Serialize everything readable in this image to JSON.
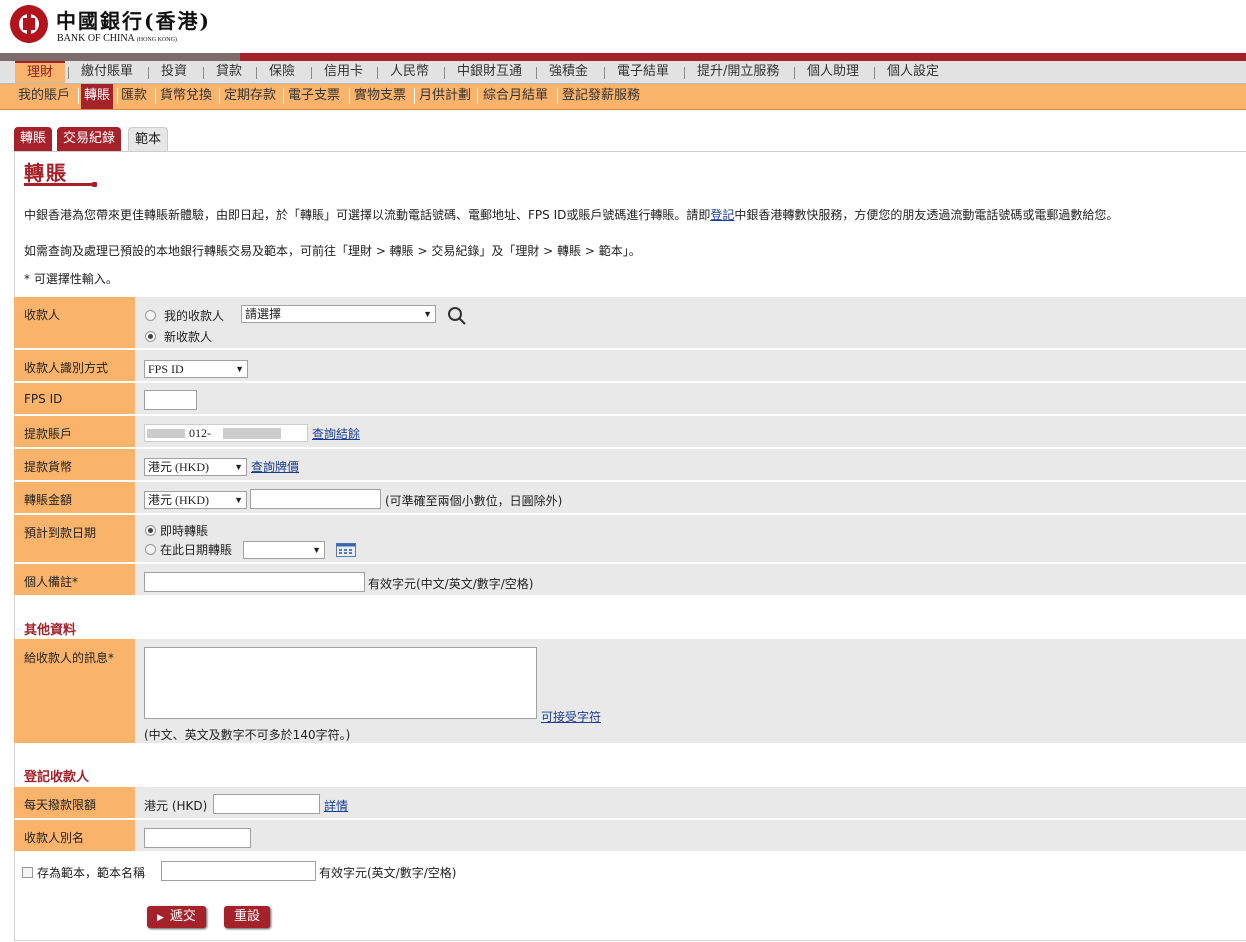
{
  "header": {
    "logo_cn": "中國銀行(香港)",
    "logo_en": "BANK OF CHINA",
    "logo_en_small": "(HONG KONG)"
  },
  "nav_main": [
    "理財",
    "繳付賬單",
    "投資",
    "貸款",
    "保險",
    "信用卡",
    "人民幣",
    "中銀財互通",
    "強積金",
    "電子結單",
    "提升/開立服務",
    "個人助理",
    "個人設定"
  ],
  "nav_sub": [
    "我的賬戶",
    "轉賬",
    "匯款",
    "貨幣兌換",
    "定期存款",
    "電子支票",
    "實物支票",
    "月供計劃",
    "綜合月結單",
    "登記發薪服務"
  ],
  "tabs": [
    "轉賬",
    "交易紀錄",
    "範本"
  ],
  "page_title": "轉賬",
  "intro": {
    "line1_a": "中銀香港為您帶來更佳轉賬新體驗，由即日起，於「轉賬」可選擇以流動電話號碼、電郵地址、FPS ID或賬戶號碼進行轉賬。請即",
    "line1_link": "登記",
    "line1_b": "中銀香港轉數快服務，方便您的朋友透過流動電話號碼或電郵過數給您。",
    "line2": "如需查詢及處理已預設的本地銀行轉賬交易及範本，可前往「理財 > 轉賬 > 交易紀錄」及「理財 > 轉賬 > 範本」。",
    "line3": "* 可選擇性輸入。"
  },
  "form": {
    "payee_label": "收款人",
    "my_payee": "我的收款人",
    "payee_select": "請選擇",
    "new_payee": "新收款人",
    "id_method_label": "收款人識別方式",
    "id_method_value": "FPS ID",
    "fps_label": "FPS ID",
    "fps_value": "",
    "debit_label": "提款賬戶",
    "debit_value": "012-",
    "balance_link": "查詢結餘",
    "currency_label": "提款貨幣",
    "currency_value": "港元 (HKD)",
    "rate_link": "查詢牌價",
    "amount_label": "轉賬金額",
    "amount_currency": "港元 (HKD)",
    "amount_value": "",
    "amount_hint": "(可準確至兩個小數位，日圓除外)",
    "date_label": "預計到款日期",
    "date_now": "即時轉賬",
    "date_on": "在此日期轉賬",
    "date_value": "",
    "memo_label": "個人備註*",
    "memo_value": "",
    "memo_hint": "有效字元(中文/英文/數字/空格)"
  },
  "other": {
    "title": "其他資料",
    "msg_label": "給收款人的訊息*",
    "msg_value": "",
    "accept_link": "可接受字符",
    "msg_hint": "(中文、英文及數字不可多於140字符。)"
  },
  "register": {
    "title": "登記收款人",
    "limit_label": "每天撥款限額",
    "limit_currency": "港元 (HKD)",
    "limit_value": "",
    "detail_link": "詳情",
    "alias_label": "收款人別名",
    "alias_value": ""
  },
  "template": {
    "save_label": "存為範本，範本名稱",
    "name_value": "",
    "hint": "有效字元(英文/數字/空格)"
  },
  "buttons": {
    "submit": "遞交",
    "reset": "重設"
  },
  "colors": {
    "brand_red": "#a5222b",
    "orange": "#f9b36a"
  }
}
